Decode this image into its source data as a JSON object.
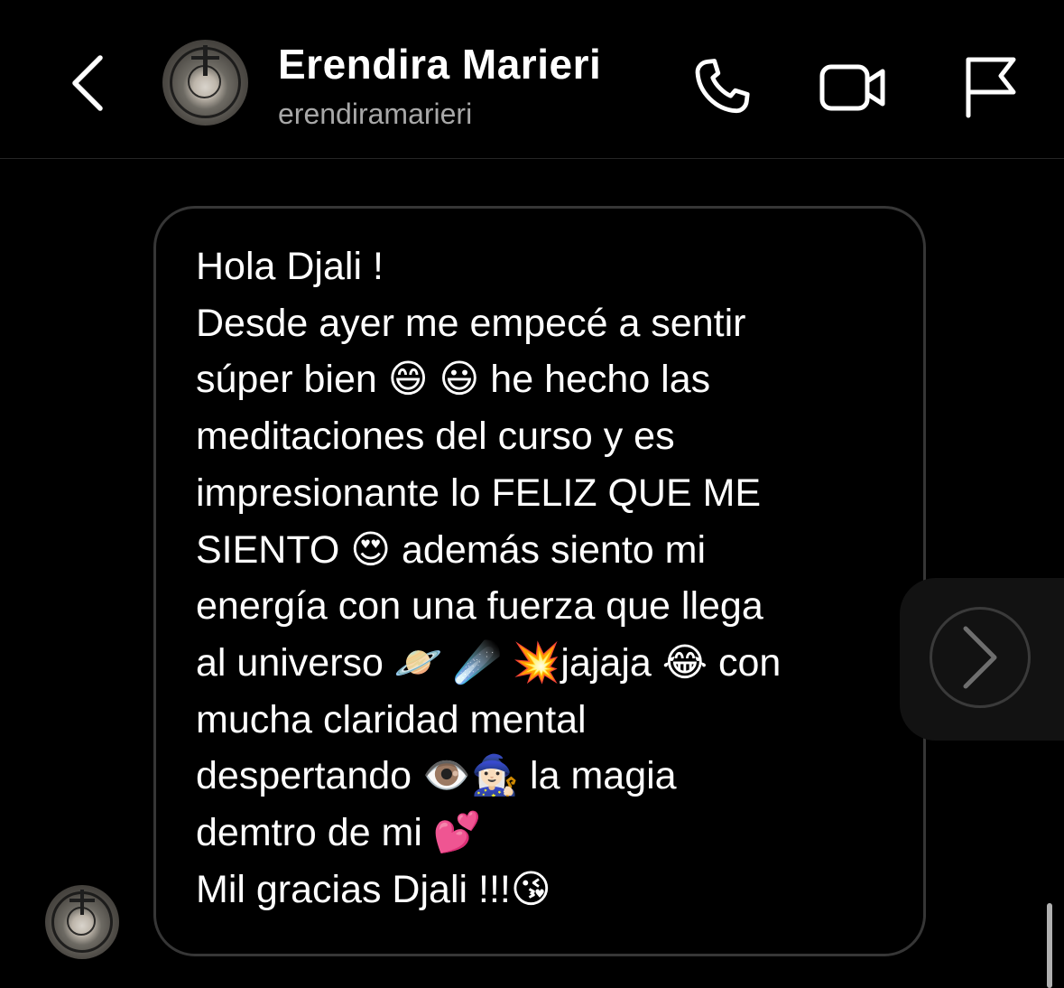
{
  "header": {
    "back_icon": "chevron-left-icon",
    "display_name": "Erendira Marieri",
    "username": "erendiramarieri",
    "actions": [
      {
        "name": "call",
        "icon": "phone-icon"
      },
      {
        "name": "video",
        "icon": "video-camera-icon"
      },
      {
        "name": "report",
        "icon": "flag-icon"
      }
    ]
  },
  "message": {
    "text": "Hola Djali !\nDesde ayer me empecé a sentir\nsúper bien 😄 😃  he hecho las\nmeditaciones del curso y es\nimpresionante lo FELIZ QUE ME\nSIENTO 😍  además siento mi\nenergía  con una fuerza  que llega\nal universo  🪐 ☄️ 💥jajaja 😂  con\nmucha claridad mental\ndespertando 👁️🧙🏻‍♀️ la magia\ndemtro de mi 💕\nMil gracias Djali !!!😘"
  },
  "forward_icon": "chevron-right-icon",
  "colors": {
    "background": "#000000",
    "secondary_text": "#a8a8a8",
    "bubble_border": "#363636"
  }
}
